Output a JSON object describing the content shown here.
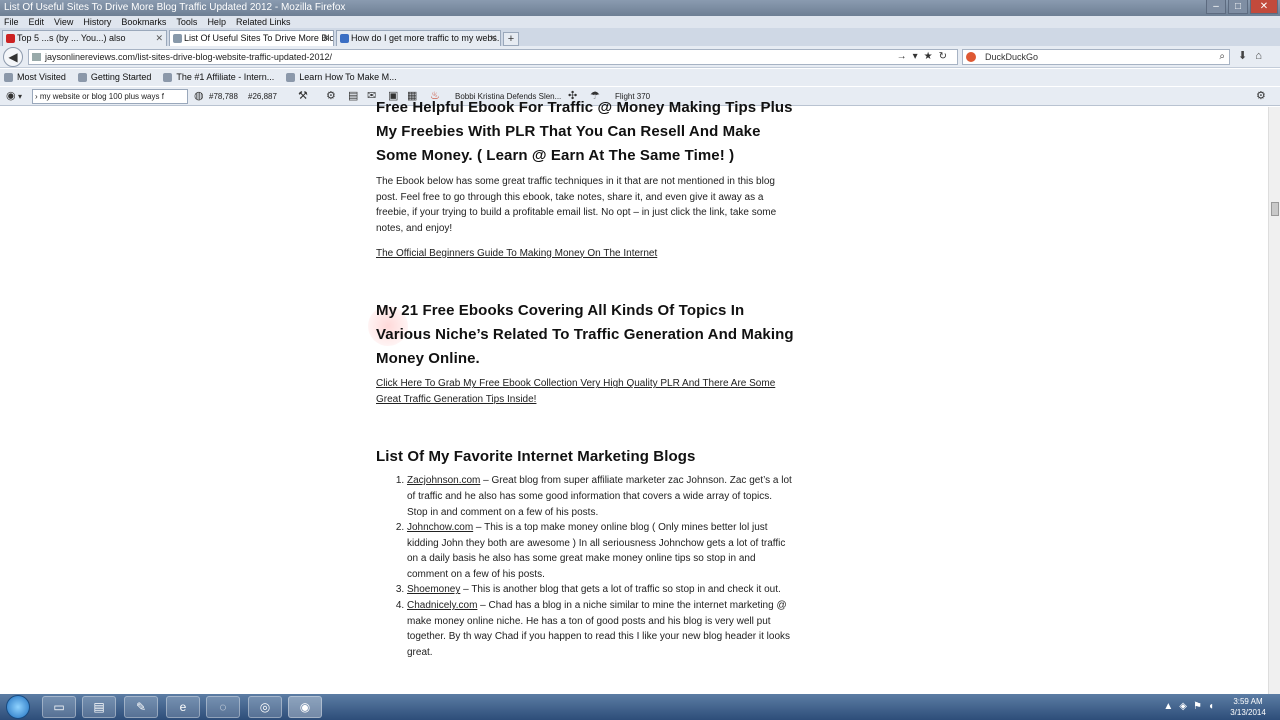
{
  "window": {
    "title": "List Of Useful Sites To Drive More Blog Traffic Updated 2012 - Mozilla Firefox"
  },
  "menu": [
    "File",
    "Edit",
    "View",
    "History",
    "Bookmarks",
    "Tools",
    "Help",
    "Related Links"
  ],
  "tabs": [
    {
      "label": "Top 5 ...s (by ... You...) also",
      "active": false
    },
    {
      "label": "List Of Useful Sites To Drive More Blo...",
      "active": true
    },
    {
      "label": "How do I get more traffic to my webs...",
      "active": false
    }
  ],
  "nav": {
    "url": "jaysonlinereviews.com/list-sites-drive-blog-website-traffic-updated-2012/",
    "search_placeholder": "DuckDuckGo"
  },
  "bookmarks": [
    "Most Visited",
    "Getting Started",
    "The #1 Affiliate - Intern...",
    "Learn How To Make M..."
  ],
  "toolbar": {
    "search_value": "› my website or blog 100 plus ways f",
    "rank1": "#78,788",
    "rank2": "#26,887",
    "news": "Bobbi Kristina Defends Slen...",
    "flight": "Flight 370"
  },
  "article": {
    "heading1": "Free Helpful Ebook For Traffic @ Money Making Tips Plus My Freebies With PLR That You Can Resell And Make Some Money. ( Learn @ Earn At The Same Time! )",
    "para1": "The Ebook below has some great traffic techniques in it that are not mentioned in this blog post. Feel free to go through this ebook, take notes, share it, and even give it away as a freebie, if your trying to build a profitable email list. No opt – in just click the link, take some notes, and enjoy!",
    "link1": "The Official Beginners Guide To Making Money On The Internet",
    "heading2": "My 21 Free Ebooks Covering All Kinds Of Topics In Various Niche’s Related To Traffic Generation And Making Money Online.",
    "link2": "Click Here To Grab My Free Ebook Collection Very High Quality PLR And There Are Some Great Traffic Generation Tips Inside!",
    "heading3": "List Of My Favorite Internet Marketing Blogs",
    "blogs": [
      {
        "name": "Zacjohnson.com",
        "desc": " – Great blog from super affiliate marketer zac Johnson. Zac get’s a lot of traffic and he also has some good information that covers a wide array of topics. Stop in and comment on a few of his posts."
      },
      {
        "name": "Johnchow.com",
        "desc": " – This is a top make money online blog ( Only mines better lol just kidding John they both are awesome ) In all seriousness Johnchow gets a lot of traffic on a daily basis he also has some great make money online tips so stop in and comment on a few of his posts."
      },
      {
        "name": "Shoemoney",
        "desc": " – This is another blog that gets a lot of traffic so stop in and check it out."
      },
      {
        "name": "Chadnicely.com",
        "desc": " – Chad has a blog in a niche similar to mine the internet marketing @ make money online niche. He has a ton of good posts and his blog is very well put together. By th way Chad if you happen to read this I like your new blog header it looks great."
      }
    ]
  },
  "clock": {
    "time": "3:59 AM",
    "date": "3/13/2014"
  }
}
